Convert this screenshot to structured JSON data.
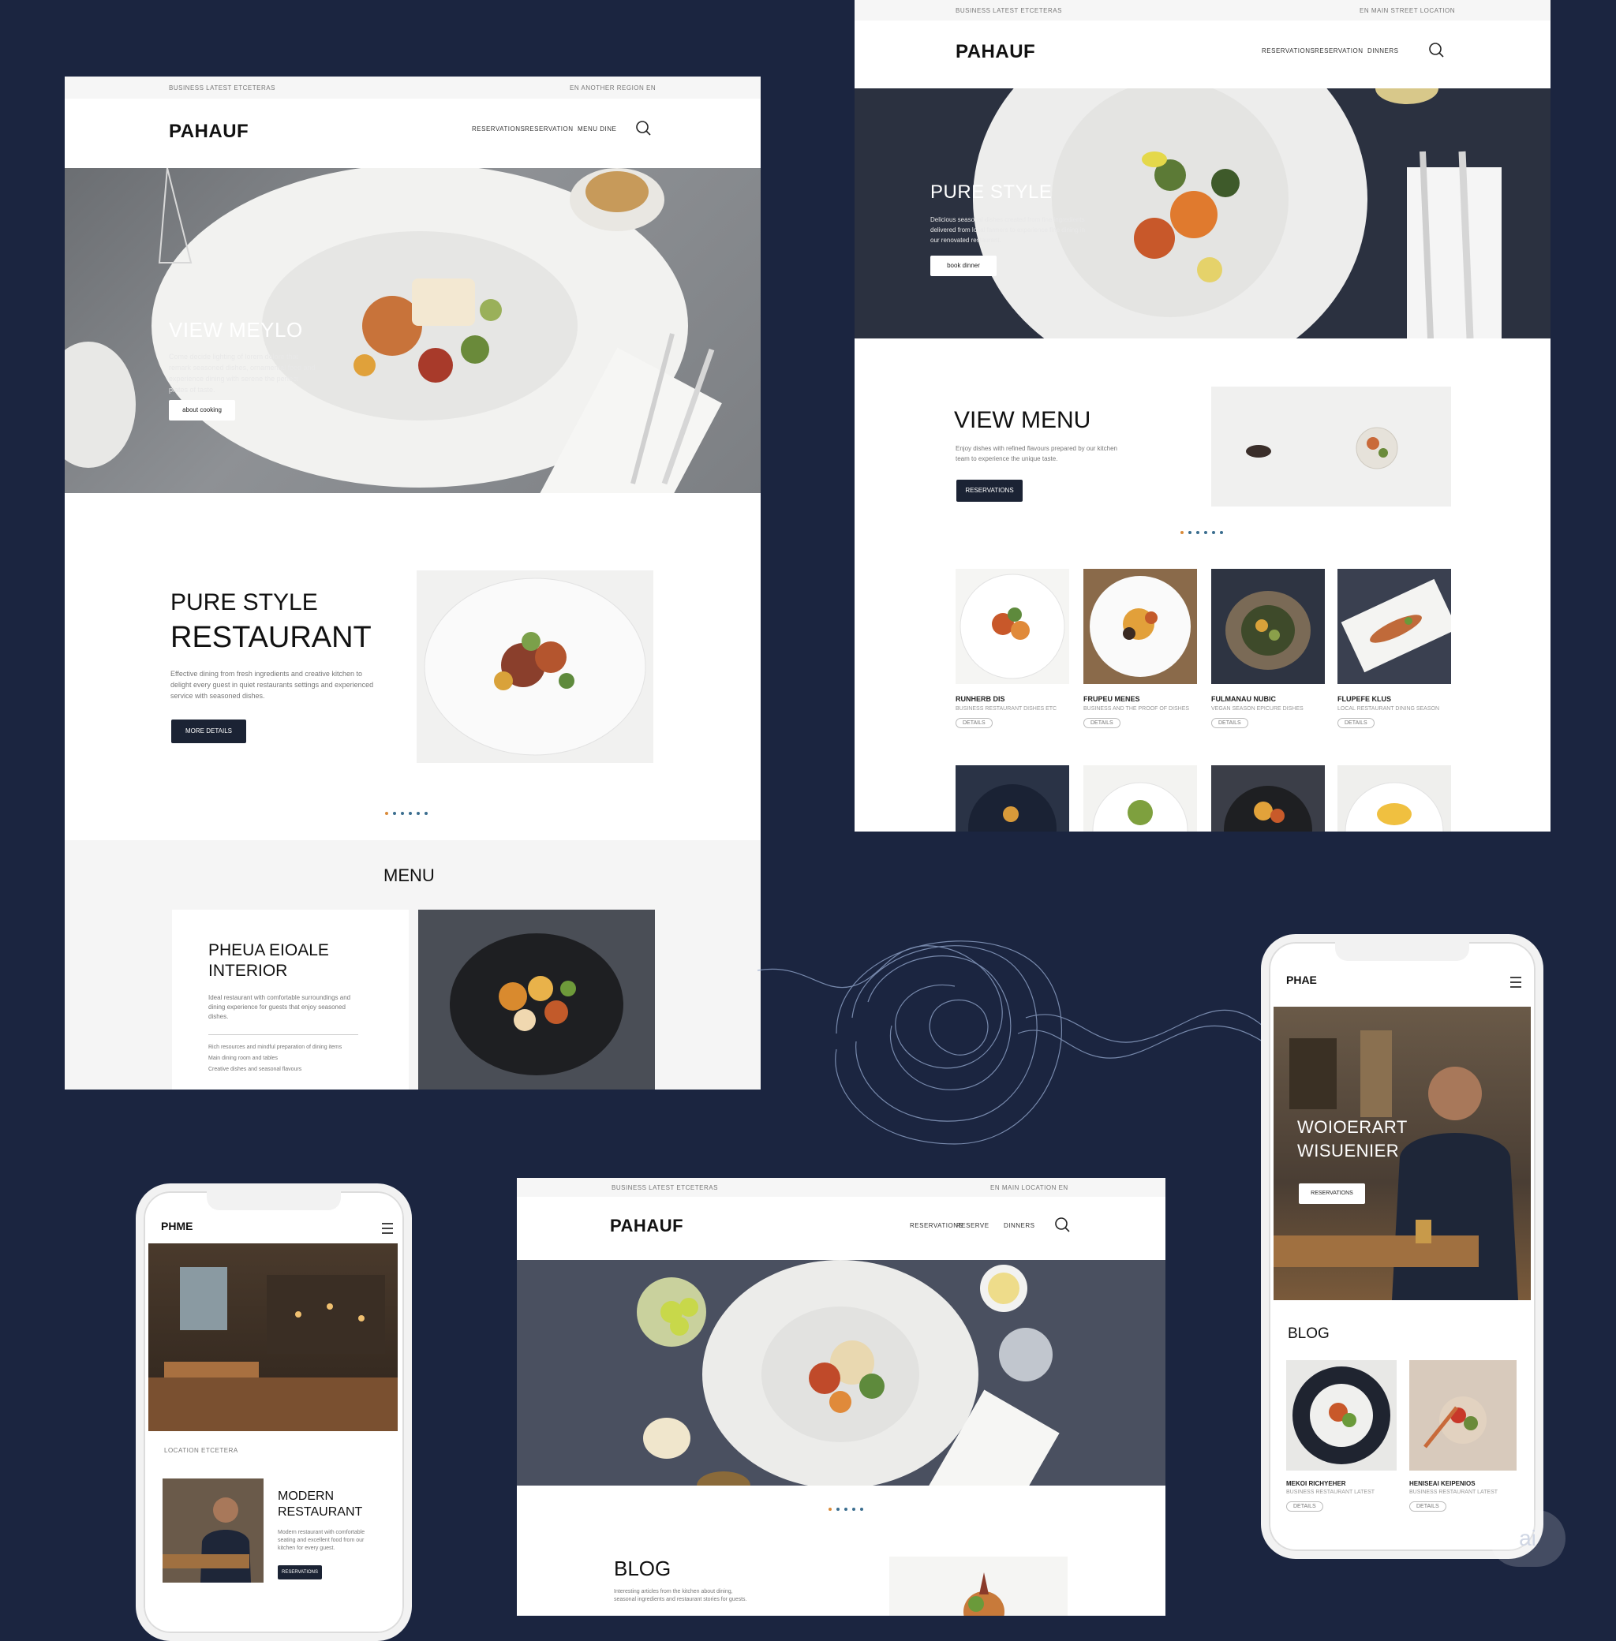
{
  "brand": {
    "desktop_logo": "PAHAUF",
    "phone_logo": "PHAE",
    "phone_logo_left": "PHME"
  },
  "colors": {
    "background": "#1b2540",
    "button_dark": "#1b2334",
    "dot_accent": "#d98b3a",
    "dot_primary": "#3b6e8f"
  },
  "mockup_a": {
    "topbar_left": "BUSINESS LATEST ETCETERAS",
    "topbar_right": "EN   ANOTHER REGION   EN",
    "nav": [
      "RESERVATIONS",
      "RESERVATION",
      "MENU DINE"
    ],
    "hero": {
      "title": "VIEW MEYLO",
      "desc": "Come decide lighting of lorem dolore that remark seasoned dishes, ornamental food and experience dining with serene the perfect plates of taste.",
      "button": "about cooking"
    },
    "intro": {
      "title_line1": "PURE STYLE",
      "title_line2": "RESTAURANT",
      "desc": "Effective dining from fresh ingredients and creative kitchen to delight every guest in quiet restaurants settings and experienced service with seasoned dishes.",
      "button": "MORE DETAILS"
    },
    "menu_heading": "MENU",
    "feature": {
      "title_line1": "PHEUA EIOALE",
      "title_line2": "INTERIOR",
      "desc": "Ideal restaurant with comfortable surroundings and dining experience for guests that enjoy seasoned dishes.",
      "bullets": [
        "Rich resources and mindful preparation of dining items",
        "Main dining room and tables",
        "Creative dishes and seasonal flavours"
      ]
    }
  },
  "mockup_b": {
    "topbar_left": "BUSINESS LATEST ETCETERAS",
    "topbar_right": "EN   MAIN STREET LOCATION",
    "nav": [
      "RESERVATIONS",
      "RESERVATION",
      "DINNERS"
    ],
    "hero": {
      "title": "PURE STYLE",
      "desc": "Delicious seasonal dishes created from fine ingredients delivered from local farmers to experience fine dining in our renovated restaurant.",
      "button": "book dinner"
    },
    "view_menu": {
      "title": "VIEW MENU",
      "desc": "Enjoy dishes with refined flavours prepared by our kitchen team to experience the unique taste.",
      "button": "RESERVATIONS"
    },
    "dishes": [
      {
        "name": "RUNHERB DIS",
        "desc": "BUSINESS RESTAURANT DISHES ETC",
        "tag": "DETAILS"
      },
      {
        "name": "FRUPEU MENES",
        "desc": "BUSINESS AND THE PROOF OF DISHES",
        "tag": "DETAILS"
      },
      {
        "name": "FULMANAU NUBIC",
        "desc": "VEGAN SEASON EPICURE DISHES",
        "tag": "DETAILS"
      },
      {
        "name": "FLUPEFE KLUS",
        "desc": "LOCAL RESTAURANT DINING SEASON",
        "tag": "DETAILS"
      }
    ]
  },
  "mockup_c": {
    "topbar_left": "BUSINESS LATEST ETCETERAS",
    "topbar_right": "EN   MAIN LOCATION   EN",
    "nav": [
      "RESERVATIONS",
      "RESERVE",
      "DINNERS"
    ],
    "blog_title": "BLOG",
    "blog_desc": "Interesting articles from the kitchen about dining, seasonal ingredients and restaurant stories for guests."
  },
  "phone_left": {
    "caption": "LOCATION ETCETERA",
    "feature_title_line1": "MODERN",
    "feature_title_line2": "RESTAURANT",
    "feature_desc": "Modern restaurant with comfortable seating and excellent food from our kitchen for every guest.",
    "button": "RESERVATIONS"
  },
  "phone_right": {
    "hero_title_line1": "WOIOERART",
    "hero_title_line2": "WISUENIER",
    "hero_button": "RESERVATIONS",
    "blog_title": "BLOG",
    "posts": [
      {
        "title": "MEKOI RICHYEHER",
        "desc": "BUSINESS RESTAURANT LATEST",
        "tag": "DETAILS"
      },
      {
        "title": "HENISEAI KEIPENIOS",
        "desc": "BUSINESS RESTAURANT LATEST",
        "tag": "DETAILS"
      }
    ]
  },
  "badge": "ai"
}
